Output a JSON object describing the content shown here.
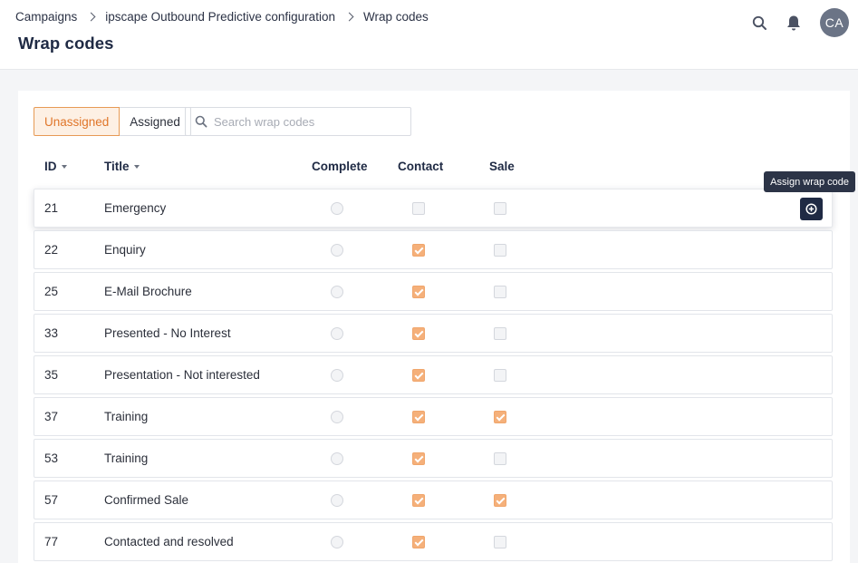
{
  "breadcrumb": [
    "Campaigns",
    "ipscape Outbound Predictive configuration",
    "Wrap codes"
  ],
  "page_title": "Wrap codes",
  "user": {
    "initials": "CA"
  },
  "icons": {
    "search": "search-icon",
    "notifications": "bell-icon",
    "assign": "plus-circle-icon"
  },
  "colors": {
    "accent": "#e0762a",
    "checked": "#f5b07a",
    "dark": "#1f2a44"
  },
  "tabs": {
    "unassigned": "Unassigned",
    "assigned": "Assigned",
    "active": "Unassigned"
  },
  "search": {
    "placeholder": "Search wrap codes",
    "value": ""
  },
  "columns": {
    "id": "ID",
    "title": "Title",
    "complete": "Complete",
    "contact": "Contact",
    "sale": "Sale"
  },
  "tooltip": "Assign wrap code",
  "rows": [
    {
      "id": "21",
      "title": "Emergency",
      "complete": false,
      "contact": false,
      "sale": false
    },
    {
      "id": "22",
      "title": "Enquiry",
      "complete": false,
      "contact": true,
      "sale": false
    },
    {
      "id": "25",
      "title": "E-Mail Brochure",
      "complete": false,
      "contact": true,
      "sale": false
    },
    {
      "id": "33",
      "title": "Presented - No Interest",
      "complete": false,
      "contact": true,
      "sale": false
    },
    {
      "id": "35",
      "title": "Presentation - Not interested",
      "complete": false,
      "contact": true,
      "sale": false
    },
    {
      "id": "37",
      "title": "Training",
      "complete": false,
      "contact": true,
      "sale": true
    },
    {
      "id": "53",
      "title": "Training",
      "complete": false,
      "contact": true,
      "sale": false
    },
    {
      "id": "57",
      "title": "Confirmed Sale",
      "complete": false,
      "contact": true,
      "sale": true
    },
    {
      "id": "77",
      "title": "Contacted and resolved",
      "complete": false,
      "contact": true,
      "sale": false
    }
  ]
}
